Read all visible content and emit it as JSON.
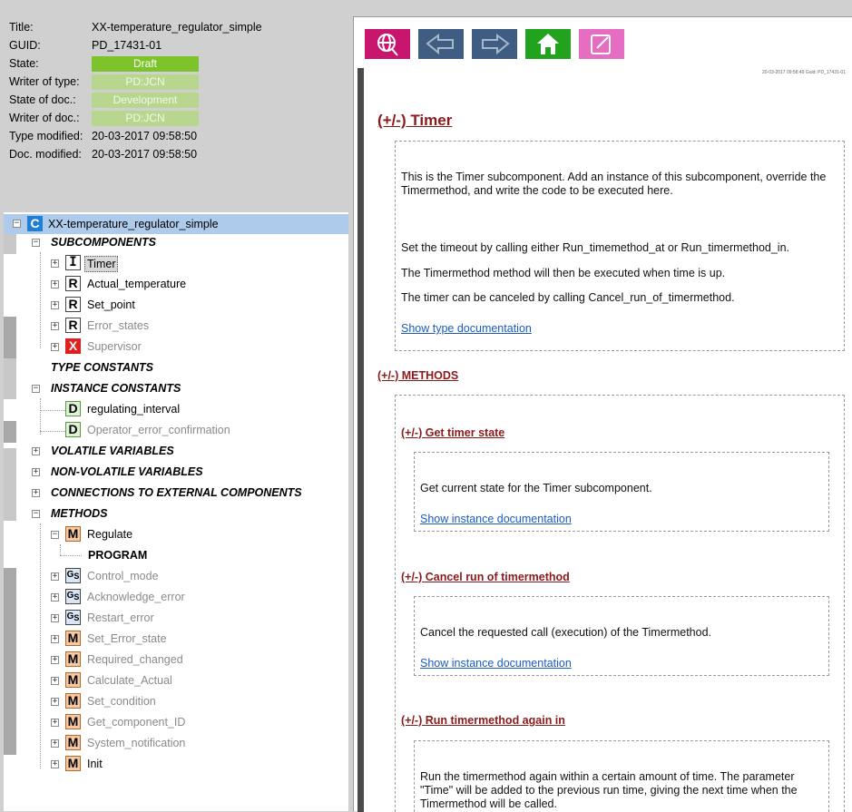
{
  "info": {
    "title_label": "Title:",
    "title_value": "XX-temperature_regulator_simple",
    "guid_label": "GUID:",
    "guid_value": "PD_17431-01",
    "state_label": "State:",
    "state_value": "Draft",
    "writer_type_label": "Writer of type:",
    "writer_type_value": "PD:JCN",
    "state_doc_label": "State of doc.:",
    "state_doc_value": "Development",
    "writer_doc_label": "Writer of doc.:",
    "writer_doc_value": "PD:JCN",
    "type_mod_label": "Type modified:",
    "type_mod_value": "20-03-2017 09:58:50",
    "doc_mod_label": "Doc. modified:",
    "doc_mod_value": "20-03-2017 09:58:50",
    "colors": {
      "draft": "#7cc42a",
      "dim": "#b8d68e"
    }
  },
  "tree": {
    "root": "XX-temperature_regulator_simple",
    "root_icon": "C",
    "subcomponents": "SUBCOMPONENTS",
    "timer": "Timer",
    "actual_temperature": "Actual_temperature",
    "set_point": "Set_point",
    "error_states": "Error_states",
    "supervisor": "Supervisor",
    "type_constants": "TYPE CONSTANTS",
    "instance_constants": "INSTANCE CONSTANTS",
    "regulating_interval": "regulating_interval",
    "operator_error_confirmation": "Operator_error_confirmation",
    "volatile_variables": "VOLATILE VARIABLES",
    "non_volatile_variables": "NON-VOLATILE VARIABLES",
    "connections": "CONNECTIONS TO EXTERNAL COMPONENTS",
    "methods": "METHODS",
    "regulate": "Regulate",
    "program": "PROGRAM",
    "control_mode": "Control_mode",
    "acknowledge_error": "Acknowledge_error",
    "restart_error": "Restart_error",
    "set_error_state": "Set_Error_state",
    "required_changed": "Required_changed",
    "calculate_actual": "Calculate_Actual",
    "set_condition": "Set_condition",
    "get_component_id": "Get_component_ID",
    "system_notification": "System_notification",
    "init": "Init",
    "icons": {
      "I": "I",
      "R": "R",
      "X": "X",
      "D": "D",
      "M": "M",
      "G": "G",
      "S": "S"
    }
  },
  "toolbar": {
    "icons": [
      "search-globe-icon",
      "arrow-left-icon",
      "arrow-right-icon",
      "home-icon",
      "edit-icon"
    ],
    "colors": {
      "search": "#c8166e",
      "nav": "#3f5d82",
      "home": "#22a31e",
      "edit": "#e56ec3"
    }
  },
  "doc": {
    "stamp": "20-03-2017 09:58:49 Guid: PD_17431-01",
    "heading": "(+/-) Timer",
    "intro": "This is the Timer subcomponent. Add an instance of this subcomponent, override the Timermethod, and write the code to be executed here.",
    "p2": "Set the timeout by calling either Run_timemethod_at or Run_timermethod_in.",
    "p3": "The Timermethod method will then be executed when time is up.",
    "p4": "The timer can be canceled by calling Cancel_run_of_timermethod.",
    "show_type_doc": "Show type documentation",
    "methods_heading": "(+/-) METHODS",
    "m1_heading": "(+/-) Get timer state",
    "m1_text": "Get current state for the Timer subcomponent.",
    "m1_link": "Show instance documentation",
    "m2_heading": "(+/-) Cancel run of timermethod",
    "m2_text": "Cancel the requested call (execution) of the Timermethod.",
    "m2_link": "Show instance documentation",
    "m3_heading": "(+/-) Run timermethod again in",
    "m3_text": "Run the timermethod again within a certain amount of time. The parameter \"Time\" will be added to the previous run time, giving the next time when the Timermethod will be called."
  }
}
